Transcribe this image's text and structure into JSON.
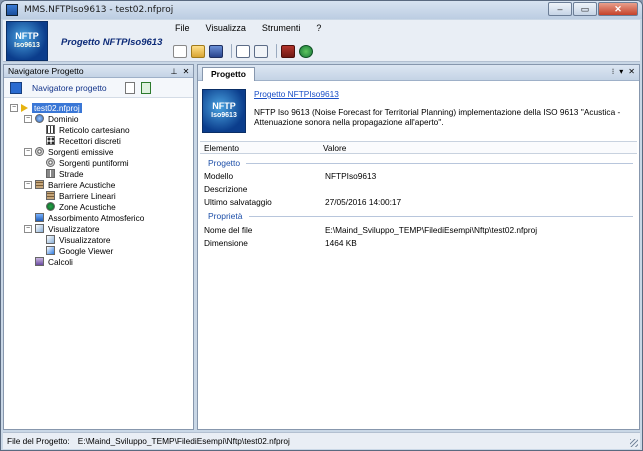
{
  "window": {
    "title": "MMS.NFTPIso9613 - test02.nfproj",
    "buttons": {
      "minimize": "–",
      "maximize": "▭",
      "close": "✕"
    }
  },
  "header": {
    "project_title": "Progetto NFTPIso9613",
    "logo_main": "NFTP",
    "logo_sub": "Iso9613",
    "menu": [
      "File",
      "Visualizza",
      "Strumenti",
      "?"
    ]
  },
  "navigator": {
    "panel_title": "Navigatore Progetto",
    "pin": "⊥",
    "close": "✕",
    "nav_title": "Navigatore progetto",
    "tree": [
      {
        "label": "test02.nfproj",
        "level": 0,
        "expander": "−",
        "icon": "project-icon",
        "selected": true
      },
      {
        "label": "Dominio",
        "level": 1,
        "expander": "−",
        "icon": "domain-icon"
      },
      {
        "label": "Reticolo cartesiano",
        "level": 2,
        "icon": "grid-icon"
      },
      {
        "label": "Recettori discreti",
        "level": 2,
        "icon": "receivers-icon"
      },
      {
        "label": "Sorgenti emissive",
        "level": 1,
        "expander": "−",
        "icon": "speaker-icon"
      },
      {
        "label": "Sorgenti puntiformi",
        "level": 2,
        "icon": "point-source-icon"
      },
      {
        "label": "Strade",
        "level": 2,
        "icon": "road-icon"
      },
      {
        "label": "Barriere Acustiche",
        "level": 1,
        "expander": "−",
        "icon": "wall-icon"
      },
      {
        "label": "Barriere Lineari",
        "level": 2,
        "icon": "barrier-icon"
      },
      {
        "label": "Zone Acustiche",
        "level": 2,
        "icon": "zone-icon"
      },
      {
        "label": "Assorbimento Atmosferico",
        "level": 1,
        "icon": "atmosphere-icon"
      },
      {
        "label": "Visualizzatore",
        "level": 1,
        "expander": "−",
        "icon": "viewer-icon"
      },
      {
        "label": "Visualizzatore",
        "level": 2,
        "icon": "viewer-icon"
      },
      {
        "label": "Google Viewer",
        "level": 2,
        "icon": "google-viewer-icon"
      },
      {
        "label": "Calcoli",
        "level": 1,
        "icon": "calc-icon"
      }
    ]
  },
  "main": {
    "tab_label": "Progetto",
    "tab_buttons": [
      "⁝",
      "▾",
      "✕"
    ],
    "info_logo_main": "NFTP",
    "info_logo_sub": "Iso9613",
    "info_link": "Progetto NFTPIso9613",
    "info_desc": "NFTP Iso 9613 (Noise Forecast for Territorial Planning) implementazione della ISO 9613 ''Acustica - Attenuazione sonora nella propagazione all'aperto''.",
    "grid_headers": [
      "Elemento",
      "Valore"
    ],
    "section_progetto": "Progetto",
    "rows_progetto": [
      {
        "key": "Modello",
        "value": "NFTPIso9613"
      },
      {
        "key": "Descrizione",
        "value": ""
      },
      {
        "key": "Ultimo salvataggio",
        "value": "27/05/2016 14:00:17"
      }
    ],
    "section_proprieta": "Proprietà",
    "rows_proprieta": [
      {
        "key": "Nome del file",
        "value": "E:\\Maind_Sviluppo_TEMP\\FilediEsempi\\Nftp\\test02.nfproj"
      },
      {
        "key": "Dimensione",
        "value": "1464 KB"
      }
    ]
  },
  "statusbar": {
    "label": "File del Progetto:",
    "path": "E:\\Maind_Sviluppo_TEMP\\FilediEsempi\\Nftp\\test02.nfproj"
  }
}
